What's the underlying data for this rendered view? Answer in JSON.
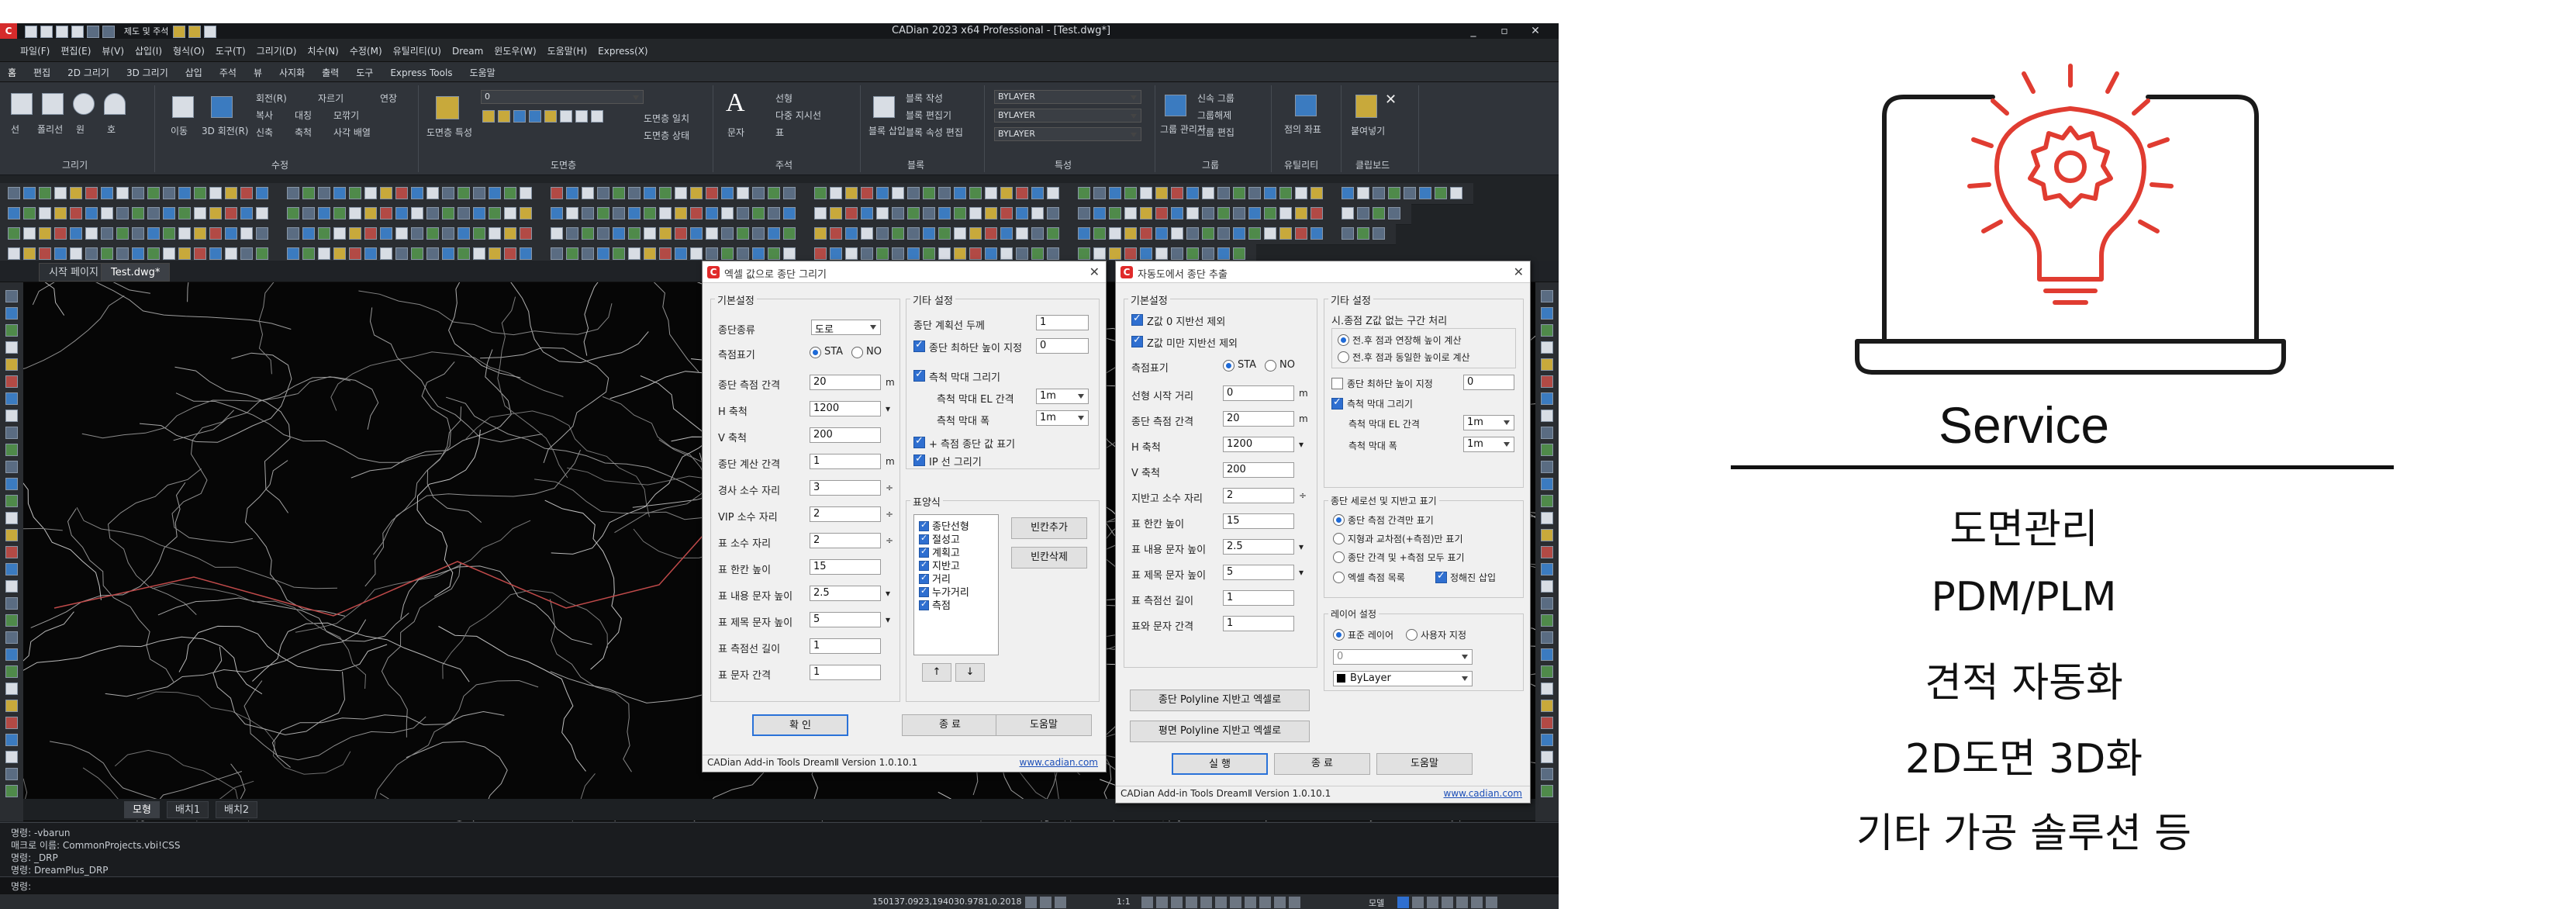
{
  "cad": {
    "window_title": "CADian 2023 x64 Professional - [Test.dwg*]",
    "quick_toolbar_text": "제도 및 주석",
    "window_controls": [
      "_",
      "▫",
      "✕"
    ],
    "menu": [
      "파일(F)",
      "편집(E)",
      "뷰(V)",
      "삽입(I)",
      "형식(O)",
      "도구(T)",
      "그리기(D)",
      "치수(N)",
      "수정(M)",
      "유틸리티(U)",
      "Dream",
      "윈도우(W)",
      "도움말(H)",
      "Express(X)"
    ],
    "ribbon_tabs": [
      "홈",
      "편집",
      "2D 그리기",
      "3D 그리기",
      "삽입",
      "주석",
      "뷰",
      "사지화",
      "출력",
      "도구",
      "Express Tools",
      "도움말"
    ],
    "ribbon": {
      "draw_labels": [
        "선",
        "폴리선",
        "원",
        "호"
      ],
      "draw_group": "그리기",
      "modify_labels": [
        "회전(R)",
        "자르기",
        "복사",
        "대칭",
        "모깎기",
        "신축",
        "축척",
        "사각 배열",
        "연장",
        "이동",
        "3D 회전(R)"
      ],
      "modify_group": "수정",
      "layer_group": "도면층",
      "layer_value": "0",
      "layer_cmds": [
        "도면층 일치",
        "도면층 상태"
      ],
      "layer_btn": "도면층 특성",
      "annot_group": "주석",
      "annot_items": [
        "선형",
        "다중 지시선",
        "표"
      ],
      "annot_btn": "문자",
      "block_group": "블록",
      "block_items": [
        "블록 작성",
        "블록 편집기",
        "블록 속성 편집"
      ],
      "block_btn": "블록 삽입",
      "prop_group": "특성",
      "prop_values": [
        "BYLAYER",
        "BYLAYER",
        "BYLAYER"
      ],
      "group_group": "그룹",
      "group_items": [
        "신속 그룹",
        "그룹해제",
        "그룹 편집"
      ],
      "group_btn": "그룹 관리자",
      "util_group": "유틸리티",
      "util_btn": "점의 좌표",
      "clip_group": "클립보드",
      "clip_btn": "붙여넣기"
    },
    "file_tabs": [
      "시작 페이지",
      "Test.dwg*"
    ],
    "layout_tabs": [
      "모형",
      "배치1",
      "배치2"
    ],
    "command_lines": [
      "명령: -vbarun",
      "매크로 이름: CommonProjects.vbi!CSS",
      "명령: _DRP",
      "명령: DreamPlus_DRP"
    ],
    "command_prompt": "명령:",
    "status_coords": "150137.0923,194030.9781,0.2018",
    "status_scale": "1:1",
    "status_model": "모델"
  },
  "dialog1": {
    "title": "엑셀 값으로 종단 그리기",
    "group_basic": "기본설정",
    "type_label": "종단종류",
    "type_value": "도로",
    "axis_label": "측점표기",
    "axis_opt1": "STA",
    "axis_opt2": "NO",
    "fields": [
      {
        "label": "종단 측점 간격",
        "value": "20",
        "unit": "m"
      },
      {
        "label": "H 축척",
        "value": "1200",
        "unit": "▾"
      },
      {
        "label": "V 축척",
        "value": "200",
        "unit": ""
      },
      {
        "label": "종단 계산 간격",
        "value": "1",
        "unit": "m"
      },
      {
        "label": "경사 소수 자리",
        "value": "3",
        "unit": "÷"
      },
      {
        "label": "VIP 소수 자리",
        "value": "2",
        "unit": "÷"
      },
      {
        "label": "표 소수 자리",
        "value": "2",
        "unit": "÷"
      },
      {
        "label": "표 한칸 높이",
        "value": "15",
        "unit": ""
      },
      {
        "label": "표 내용 문자 높이",
        "value": "2.5",
        "unit": "▾"
      },
      {
        "label": "표 제목 문자 높이",
        "value": "5",
        "unit": "▾"
      },
      {
        "label": "표 측점선 길이",
        "value": "1",
        "unit": ""
      },
      {
        "label": "표 문자 간격",
        "value": "1",
        "unit": ""
      }
    ],
    "group_other": "기타 설정",
    "plan_thick_label": "종단 계획선 두께",
    "plan_thick_value": "1",
    "min_height_label": "종단 최하단 높이 지정",
    "min_height_value": "0",
    "scale_label": "측척 막대 그리기",
    "scale_el_label": "측척 막대 EL 간격",
    "scale_el_value": "1m",
    "scale_w_label": "측척 막대 폭",
    "scale_w_value": "1m",
    "plus_label": "+ 측점 종단 값 표기",
    "ip_label": "IP 선 그리기",
    "group_table": "표양식",
    "table_items": [
      "종단선형",
      "절성고",
      "계획고",
      "지반고",
      "거리",
      "누가거리",
      "측점"
    ],
    "add_btn": "빈칸추가",
    "del_btn": "빈칸삭제",
    "up_btn": "↑",
    "down_btn": "↓",
    "ok_btn": "확 인",
    "exit_btn": "종 료",
    "help_btn": "도움말",
    "version": "CADian Add-in Tools DreamⅡ  Version  1.0.10.1",
    "link": "www.cadian.com"
  },
  "dialog2": {
    "title": "자동도에서 종단 추출",
    "group_basic": "기본설정",
    "excl_z0": "Z값 0 지반선 제외",
    "excl_zmin": "Z값 미만 지반선 제외",
    "axis_label": "측점표기",
    "axis_opt1": "STA",
    "axis_opt2": "NO",
    "fields": [
      {
        "label": "선형 시작 거리",
        "value": "0",
        "unit": "m"
      },
      {
        "label": "종단 측점 간격",
        "value": "20",
        "unit": "m"
      },
      {
        "label": "H 축척",
        "value": "1200",
        "unit": "▾"
      },
      {
        "label": "V 축척",
        "value": "200",
        "unit": ""
      },
      {
        "label": "지반고 소수 자리",
        "value": "2",
        "unit": "÷"
      },
      {
        "label": "표 한칸 높이",
        "value": "15",
        "unit": ""
      },
      {
        "label": "표 내용 문자 높이",
        "value": "2.5",
        "unit": "▾"
      },
      {
        "label": "표 제목 문자 높이",
        "value": "5",
        "unit": "▾"
      },
      {
        "label": "표 측점선 길이",
        "value": "1",
        "unit": ""
      },
      {
        "label": "표와 문자 간격",
        "value": "1",
        "unit": ""
      }
    ],
    "group_other": "기타 설정",
    "noz_label": "시.종점 Z값 없는 구간 처리",
    "noz_opt1": "전.후 점과 연장해 높이 계산",
    "noz_opt2": "전.후 점과 동일한 높이로 계산",
    "min_height_label": "종단 최하단 높이 지정",
    "min_height_value": "0",
    "scale_label": "측척 막대 그리기",
    "scale_el_label": "측척 막대 EL 간격",
    "scale_el_value": "1m",
    "scale_w_label": "측척 막대 폭",
    "scale_w_value": "1m",
    "group_cross": "종단 세로선 및 지반고 표기",
    "cross_opt1": "종단 측점 간격만 표기",
    "cross_opt2": "지형과 교차점(+측점)만 표기",
    "cross_opt3": "종단 간격 및 +측점 모두 표기",
    "cross_opt4": "엑셀 측점 목록",
    "cross_cb": "정해진 삽입",
    "group_layer": "레이어 설정",
    "layer_opt1": "표준 레이어",
    "layer_opt2": "사용자 지정",
    "layer_value": "0",
    "color_value": "ByLayer",
    "btn_polyline_ground": "종단 Polyline 지반고 엑셀로",
    "btn_polyline_plan": "평면 Polyline 지반고 엑셀로",
    "ok_btn": "실 행",
    "exit_btn": "종 료",
    "help_btn": "도움말",
    "version": "CADian Add-in Tools DreamⅡ  Version  1.0.10.1",
    "link": "www.cadian.com"
  },
  "service": {
    "icon": "laptop-lightbulb-gear-icon",
    "accent": "#e03c31",
    "title": "Service",
    "items": [
      "도면관리",
      "PDM/PLM",
      "견적 자동화",
      "2D도면 3D화",
      "기타 가공 솔루션 등"
    ]
  }
}
